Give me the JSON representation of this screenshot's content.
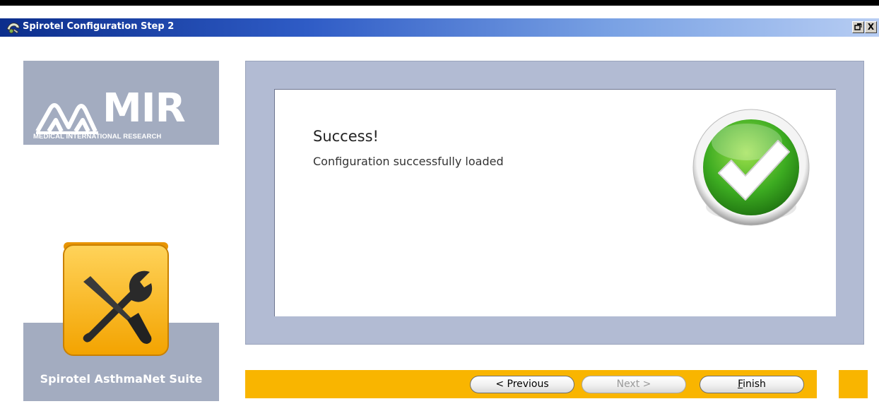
{
  "window": {
    "title": "Spirotel Configuration Step 2",
    "restore_glyph": "▫",
    "close_glyph": "X",
    "icon": "spirotel-app-icon"
  },
  "branding": {
    "logo_text": "MIR",
    "tagline": "MEDICAL INTERNATIONAL RESEARCH",
    "suite_name": "Spirotel AsthmaNet Suite",
    "suite_icon": "tools-icon",
    "panel_color": "#a3acc0"
  },
  "message": {
    "title": "Success!",
    "text": "Configuration successfully loaded",
    "status_icon": "checkmark-icon",
    "status_color": "#3cab21"
  },
  "buttons": {
    "previous_label": "< Previous",
    "next_label": "Next >",
    "finish_mnemonic": "F",
    "finish_rest": "inish",
    "next_enabled": false
  },
  "colors": {
    "accent_bar": "#f9b500",
    "content_frame": "#b2bbd3",
    "titlebar_start": "#0c2e8c",
    "titlebar_end": "#b7cdf3"
  }
}
